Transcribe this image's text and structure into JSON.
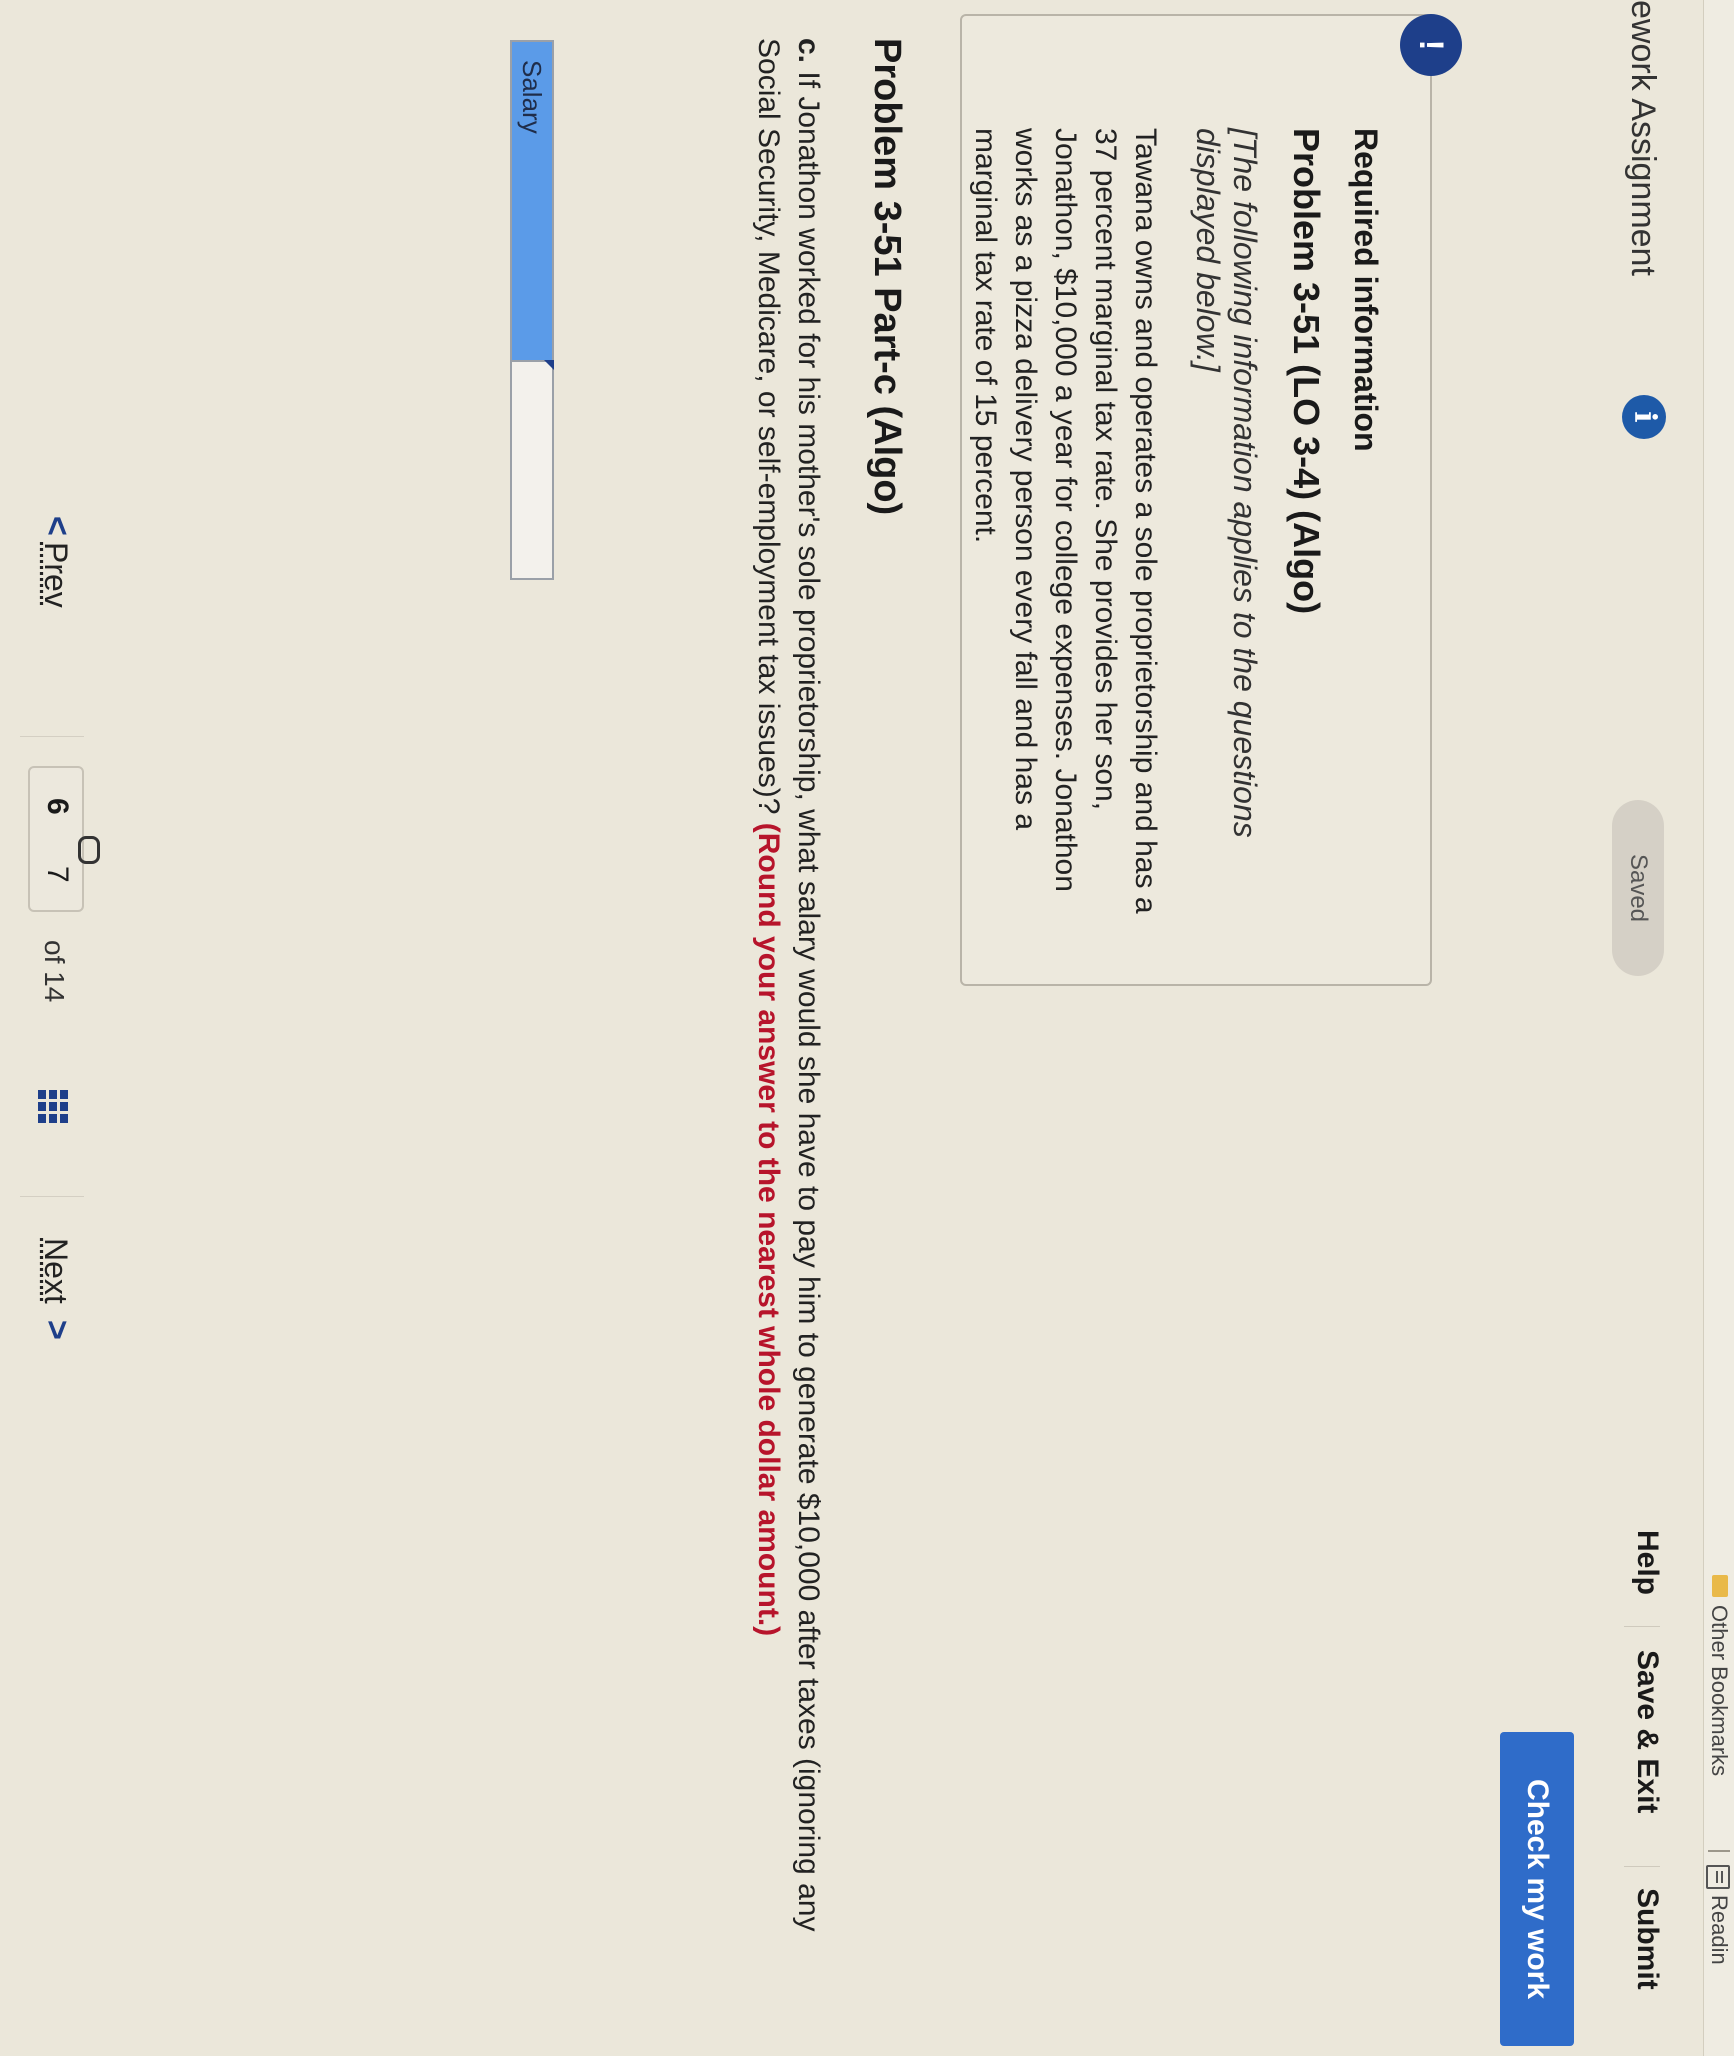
{
  "browser": {
    "bookmarks_label": "Other Bookmarks",
    "reading_label": "Readin"
  },
  "header": {
    "assignment_title": "ework Assignment",
    "saved_status": "Saved",
    "help": "Help",
    "save_exit": "Save & Exit",
    "submit": "Submit",
    "check_my_work": "Check my work"
  },
  "info_box": {
    "heading": "Required information",
    "problem_title": "Problem 3-51 (LO 3-4) (Algo)",
    "applies_note": "[The following information applies to the questions displayed below.]",
    "scenario": "Tawana owns and operates a sole proprietorship and has a 37 percent marginal tax rate. She provides her son, Jonathon, $10,000 a year for college expenses. Jonathon works as a pizza delivery person every fall and has a marginal tax rate of 15 percent."
  },
  "part": {
    "title": "Problem 3-51 Part-c (Algo)",
    "question_letter": "c.",
    "question_text": " If Jonathon worked for his mother's sole proprietorship, what salary would she have to pay him to generate $10,000 after taxes (ignoring any Social Security, Medicare, or self-employment tax issues)? ",
    "instruction": "(Round your answer to the nearest whole dollar amount.)"
  },
  "answer": {
    "label": "Salary",
    "value": ""
  },
  "nav": {
    "prev": "Prev",
    "current_page": "6",
    "next_page": "7",
    "of_total": "of 14",
    "next": "Next"
  },
  "colors": {
    "accent_blue": "#2f6cc9",
    "instruction_red": "#b7142b",
    "salary_label_bg": "#5b9be8"
  }
}
